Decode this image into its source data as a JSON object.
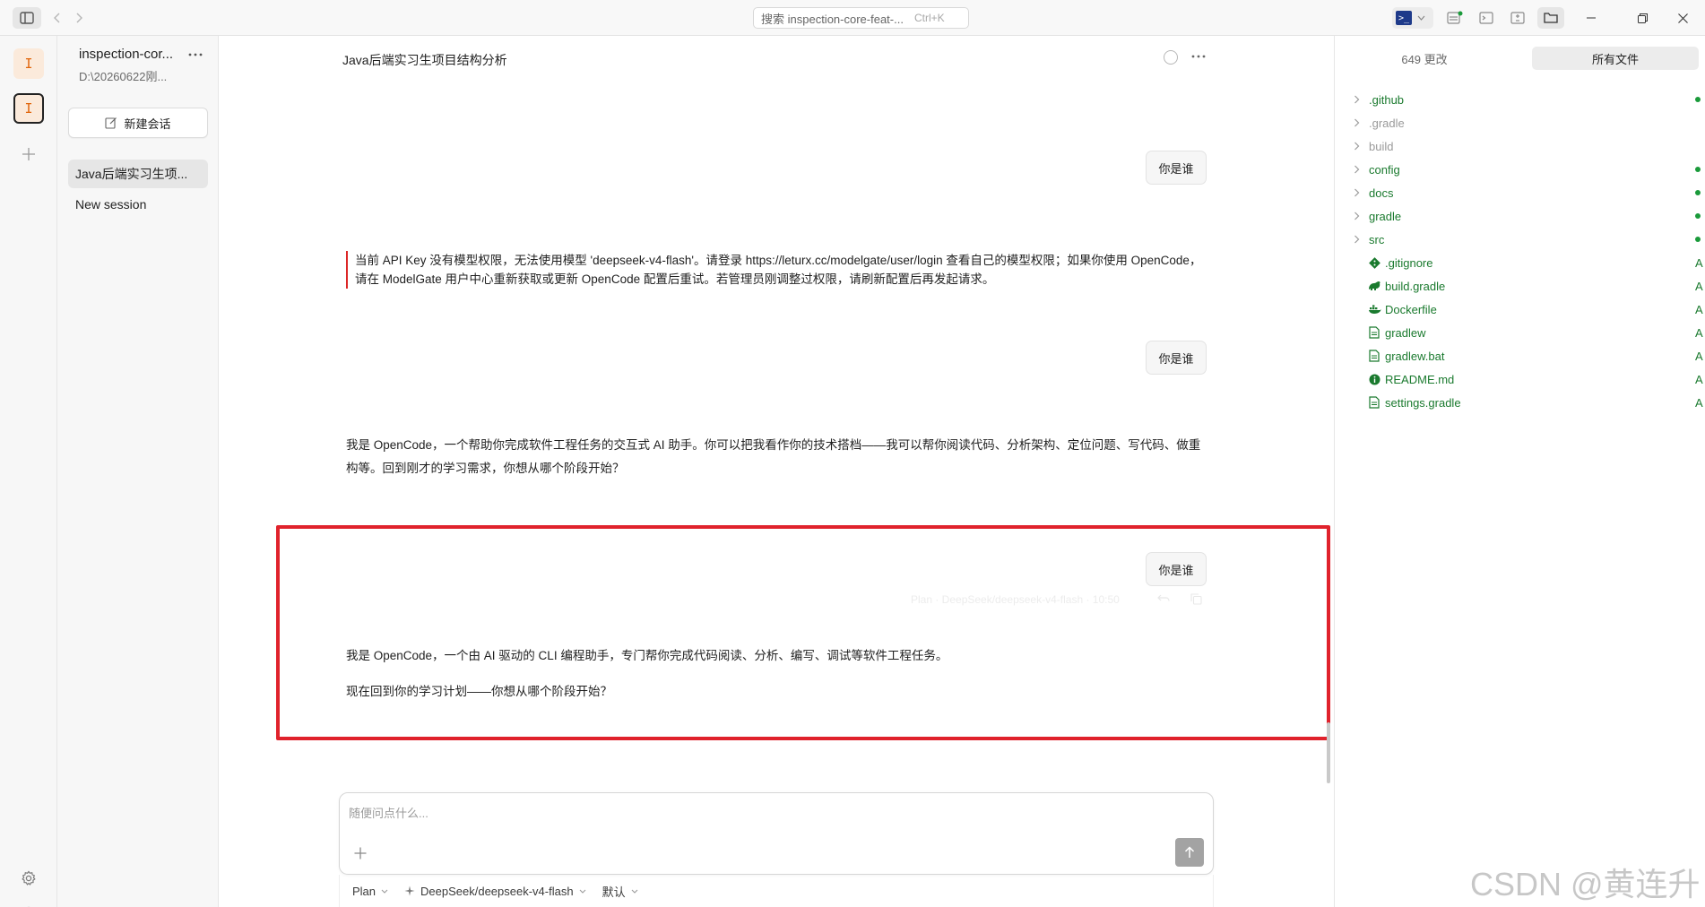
{
  "app": {
    "search": {
      "label": "搜索 inspection-core-feat-...",
      "shortcut": "Ctrl+K"
    }
  },
  "rail": {
    "workspaces": [
      {
        "letter": "I"
      },
      {
        "letter": "I"
      }
    ]
  },
  "sessions": {
    "project_name": "inspection-cor...",
    "project_path": "D:\\20260622刚...",
    "new_session_label": "新建会话",
    "items": [
      {
        "label": "Java后端实习生项..."
      },
      {
        "label": "New session"
      }
    ]
  },
  "chat": {
    "title": "Java后端实习生项目结构分析",
    "messages": [
      {
        "role": "user",
        "text": "你是谁"
      },
      {
        "role": "error",
        "text": "当前 API Key 没有模型权限，无法使用模型 'deepseek-v4-flash'。请登录 https://leturx.cc/modelgate/user/login 查看自己的模型权限；如果你使用 OpenCode，请在 ModelGate 用户中心重新获取或更新 OpenCode 配置后重试。若管理员刚调整过权限，请刷新配置后再发起请求。"
      },
      {
        "role": "user",
        "text": "你是谁"
      },
      {
        "role": "assistant",
        "text": "我是 OpenCode，一个帮助你完成软件工程任务的交互式 AI 助手。你可以把我看作你的技术搭档——我可以帮你阅读代码、分析架构、定位问题、写代码、做重构等。回到刚才的学习需求，你想从哪个阶段开始？"
      },
      {
        "role": "user",
        "text": "你是谁"
      },
      {
        "role": "assistant",
        "text": "我是 OpenCode，一个由 AI 驱动的 CLI 编程助手，专门帮你完成代码阅读、分析、编写、调试等软件工程任务。",
        "text2": "现在回到你的学习计划——你想从哪个阶段开始？"
      }
    ],
    "message_meta": "Plan · DeepSeek/deepseek-v4-flash · 10:50",
    "composer": {
      "placeholder": "随便问点什么...",
      "mode": "Plan",
      "model": "DeepSeek/deepseek-v4-flash",
      "variant": "默认"
    }
  },
  "files": {
    "tab_changes": "649 更改",
    "tab_all": "所有文件",
    "items": [
      {
        "name": ".github",
        "type": "folder",
        "status": "dot"
      },
      {
        "name": ".gradle",
        "type": "folder",
        "status": "",
        "ignored": true
      },
      {
        "name": "build",
        "type": "folder",
        "status": "",
        "ignored": true
      },
      {
        "name": "config",
        "type": "folder",
        "status": "dot"
      },
      {
        "name": "docs",
        "type": "folder",
        "status": "dot"
      },
      {
        "name": "gradle",
        "type": "folder",
        "status": "dot"
      },
      {
        "name": "src",
        "type": "folder",
        "status": "dot"
      },
      {
        "name": ".gitignore",
        "type": "file",
        "icon": "git-icon",
        "status": "A"
      },
      {
        "name": "build.gradle",
        "type": "file",
        "icon": "gradle-icon",
        "status": "A"
      },
      {
        "name": "Dockerfile",
        "type": "file",
        "icon": "docker-icon",
        "status": "A"
      },
      {
        "name": "gradlew",
        "type": "file",
        "icon": "file-icon",
        "status": "A"
      },
      {
        "name": "gradlew.bat",
        "type": "file",
        "icon": "file-icon",
        "status": "A"
      },
      {
        "name": "README.md",
        "type": "file",
        "icon": "info-icon",
        "status": "A"
      },
      {
        "name": "settings.gradle",
        "type": "file",
        "icon": "file-icon",
        "status": "A"
      }
    ]
  },
  "watermark": "CSDN @黄连升",
  "colors": {
    "accent_green": "#1a7a2e",
    "highlight_red": "#e0222c",
    "workspace_orange": "#e1660c"
  }
}
